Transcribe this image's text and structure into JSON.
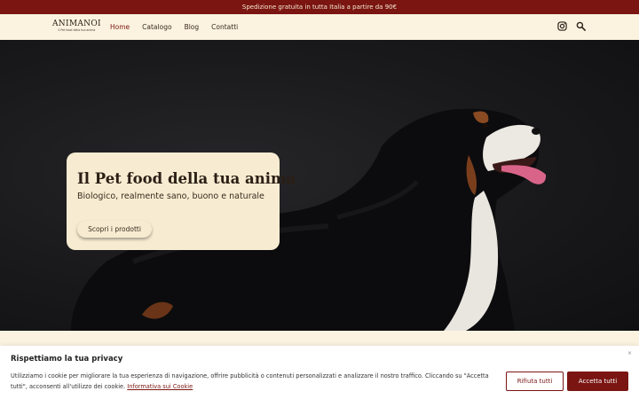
{
  "topbar": {
    "text": "Spedizione gratuita in tutta Italia a partire da 90€"
  },
  "header": {
    "logo": "ANIMANOI",
    "logo_tagline": "Il Pet food della tua anima",
    "nav": [
      {
        "label": "Home",
        "active": true
      },
      {
        "label": "Catalogo",
        "active": false
      },
      {
        "label": "Blog",
        "active": false
      },
      {
        "label": "Contatti",
        "active": false
      }
    ],
    "icons": [
      "instagram-icon",
      "search-icon"
    ]
  },
  "hero": {
    "image": "bernese-mountain-dog",
    "title": "Il Pet food della tua anima",
    "subtitle": "Biologico, realmente sano, buono e naturale",
    "button": "Scopri i prodotti"
  },
  "cookie": {
    "title": "Rispettiamo la tua privacy",
    "text": "Utilizziamo i cookie per migliorare la tua esperienza di navigazione, offrire pubblicità o contenuti personalizzati e analizzare il nostro traffico. Cliccando su \"Accetta tutti\", acconsenti all'utilizzo dei cookie. ",
    "link": "Informativa sui Cookie",
    "close": "×",
    "reject": "Rifiuta tutti",
    "accept": "Accetta tutti"
  },
  "colors": {
    "brand": "#7a1512",
    "cream": "#fbf3df",
    "card": "#f7ecd1"
  }
}
